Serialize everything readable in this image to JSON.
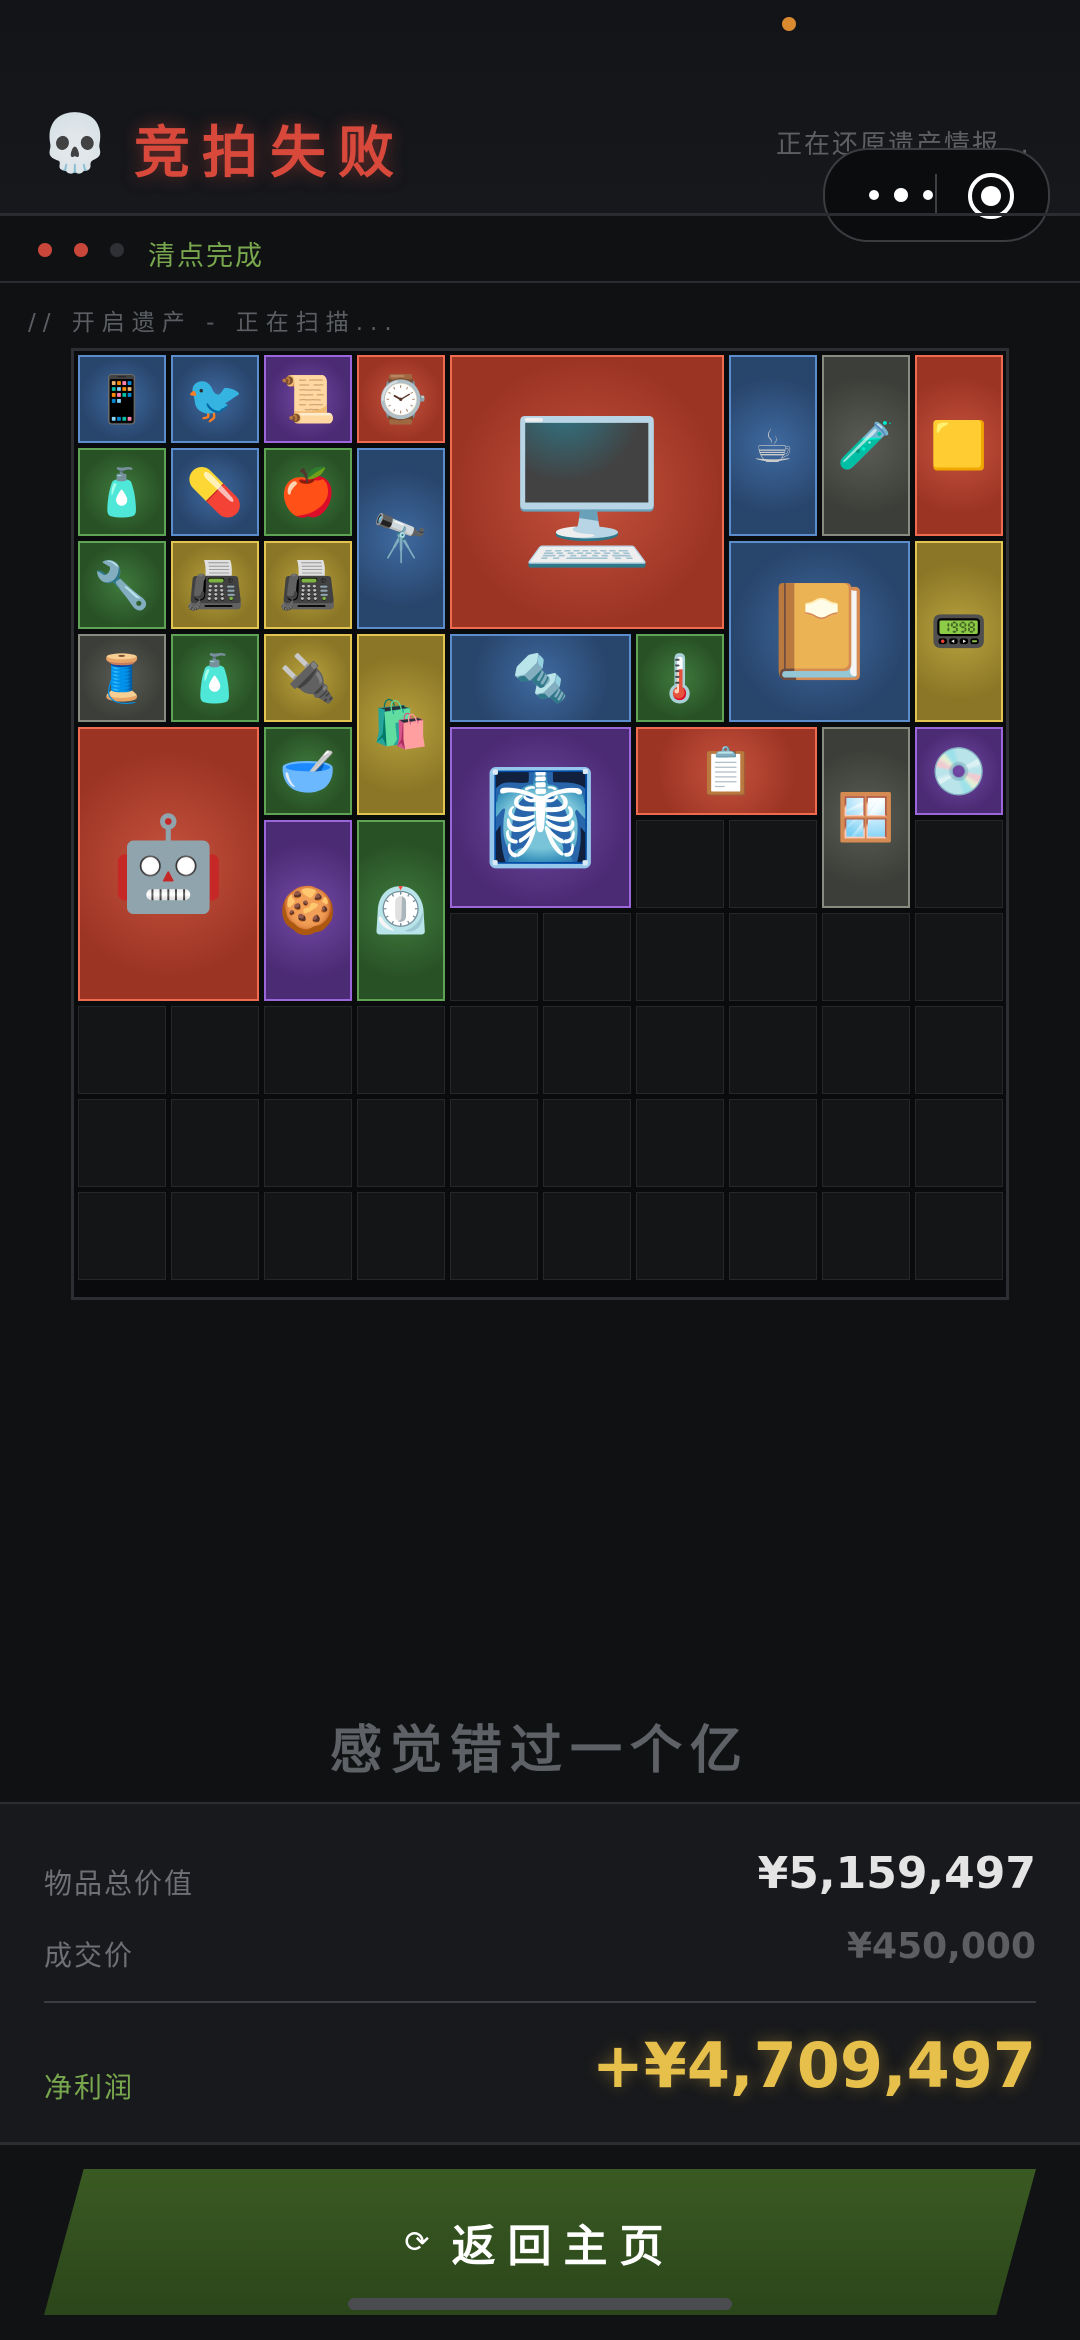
{
  "header": {
    "icon": "skull-icon",
    "title": "竞拍失败",
    "status_right": "正在还原遗产情报...",
    "status_line": "清点完成",
    "scan_line": "// 开启遗产 - 正在扫描..."
  },
  "capsule": {
    "more": "more-icon",
    "close": "target-icon"
  },
  "inventory": {
    "items": [
      {
        "name": "phone-item",
        "rarity": "blue",
        "icon": "📱"
      },
      {
        "name": "bird-figurine-item",
        "rarity": "blue",
        "icon": "🐦"
      },
      {
        "name": "scroll-item",
        "rarity": "purple",
        "icon": "📜"
      },
      {
        "name": "pocket-watch-item",
        "rarity": "red",
        "icon": "⌚"
      },
      {
        "name": "gpu-card-item",
        "rarity": "red",
        "icon": "🖥️"
      },
      {
        "name": "coffee-pot-item",
        "rarity": "blue",
        "icon": "☕"
      },
      {
        "name": "medical-vial-item",
        "rarity": "gray",
        "icon": "🧪"
      },
      {
        "name": "gold-bar-item",
        "rarity": "red",
        "icon": "🟨"
      },
      {
        "name": "medicine-bottle-item",
        "rarity": "green",
        "icon": "🧴"
      },
      {
        "name": "inhaler-item",
        "rarity": "blue",
        "icon": "💊"
      },
      {
        "name": "apple-item",
        "rarity": "green",
        "icon": "🍎"
      },
      {
        "name": "telescope-item",
        "rarity": "blue",
        "icon": "🔭"
      },
      {
        "name": "magazine-item",
        "rarity": "blue",
        "icon": "📔"
      },
      {
        "name": "radio-phone-item",
        "rarity": "gold",
        "icon": "📟"
      },
      {
        "name": "wrench-item",
        "rarity": "green",
        "icon": "🔧"
      },
      {
        "name": "meter-device-item",
        "rarity": "gold",
        "icon": "📠"
      },
      {
        "name": "meter-device-item-2",
        "rarity": "gold",
        "icon": "📠"
      },
      {
        "name": "cable-bundle-item",
        "rarity": "gray",
        "icon": "🧵"
      },
      {
        "name": "medicine-bottle-item-2",
        "rarity": "green",
        "icon": "🧴"
      },
      {
        "name": "circuit-board-item",
        "rarity": "gold",
        "icon": "🔌"
      },
      {
        "name": "coffee-bag-item",
        "rarity": "gold",
        "icon": "🛍️"
      },
      {
        "name": "drill-item",
        "rarity": "blue",
        "icon": "🔩"
      },
      {
        "name": "thermometer-item",
        "rarity": "green",
        "icon": "🌡️"
      },
      {
        "name": "robot-station-item",
        "rarity": "red",
        "icon": "🤖"
      },
      {
        "name": "tray-item",
        "rarity": "green",
        "icon": "🥣"
      },
      {
        "name": "scanner-item",
        "rarity": "purple",
        "icon": "🩻"
      },
      {
        "name": "tablet-item",
        "rarity": "red",
        "icon": "📋"
      },
      {
        "name": "glass-panel-item",
        "rarity": "gray",
        "icon": "🪟"
      },
      {
        "name": "hard-drive-item",
        "rarity": "purple",
        "icon": "💿"
      },
      {
        "name": "gingerbread-item",
        "rarity": "purple",
        "icon": "🍪"
      },
      {
        "name": "pressure-gauge-item",
        "rarity": "green",
        "icon": "⏲️"
      }
    ]
  },
  "result": {
    "slogan": "感觉错过一个亿",
    "total_label": "物品总价值",
    "total_value": "¥5,159,497",
    "deal_label": "成交价",
    "deal_value": "¥450,000",
    "profit_label": "净利润",
    "profit_value": "+¥4,709,497"
  },
  "footer": {
    "home_label": "返回主页",
    "home_icon": "⟳"
  },
  "colors": {
    "accent_red": "#d8493c",
    "success_green": "#78a74e",
    "gold": "#e7c04b"
  }
}
